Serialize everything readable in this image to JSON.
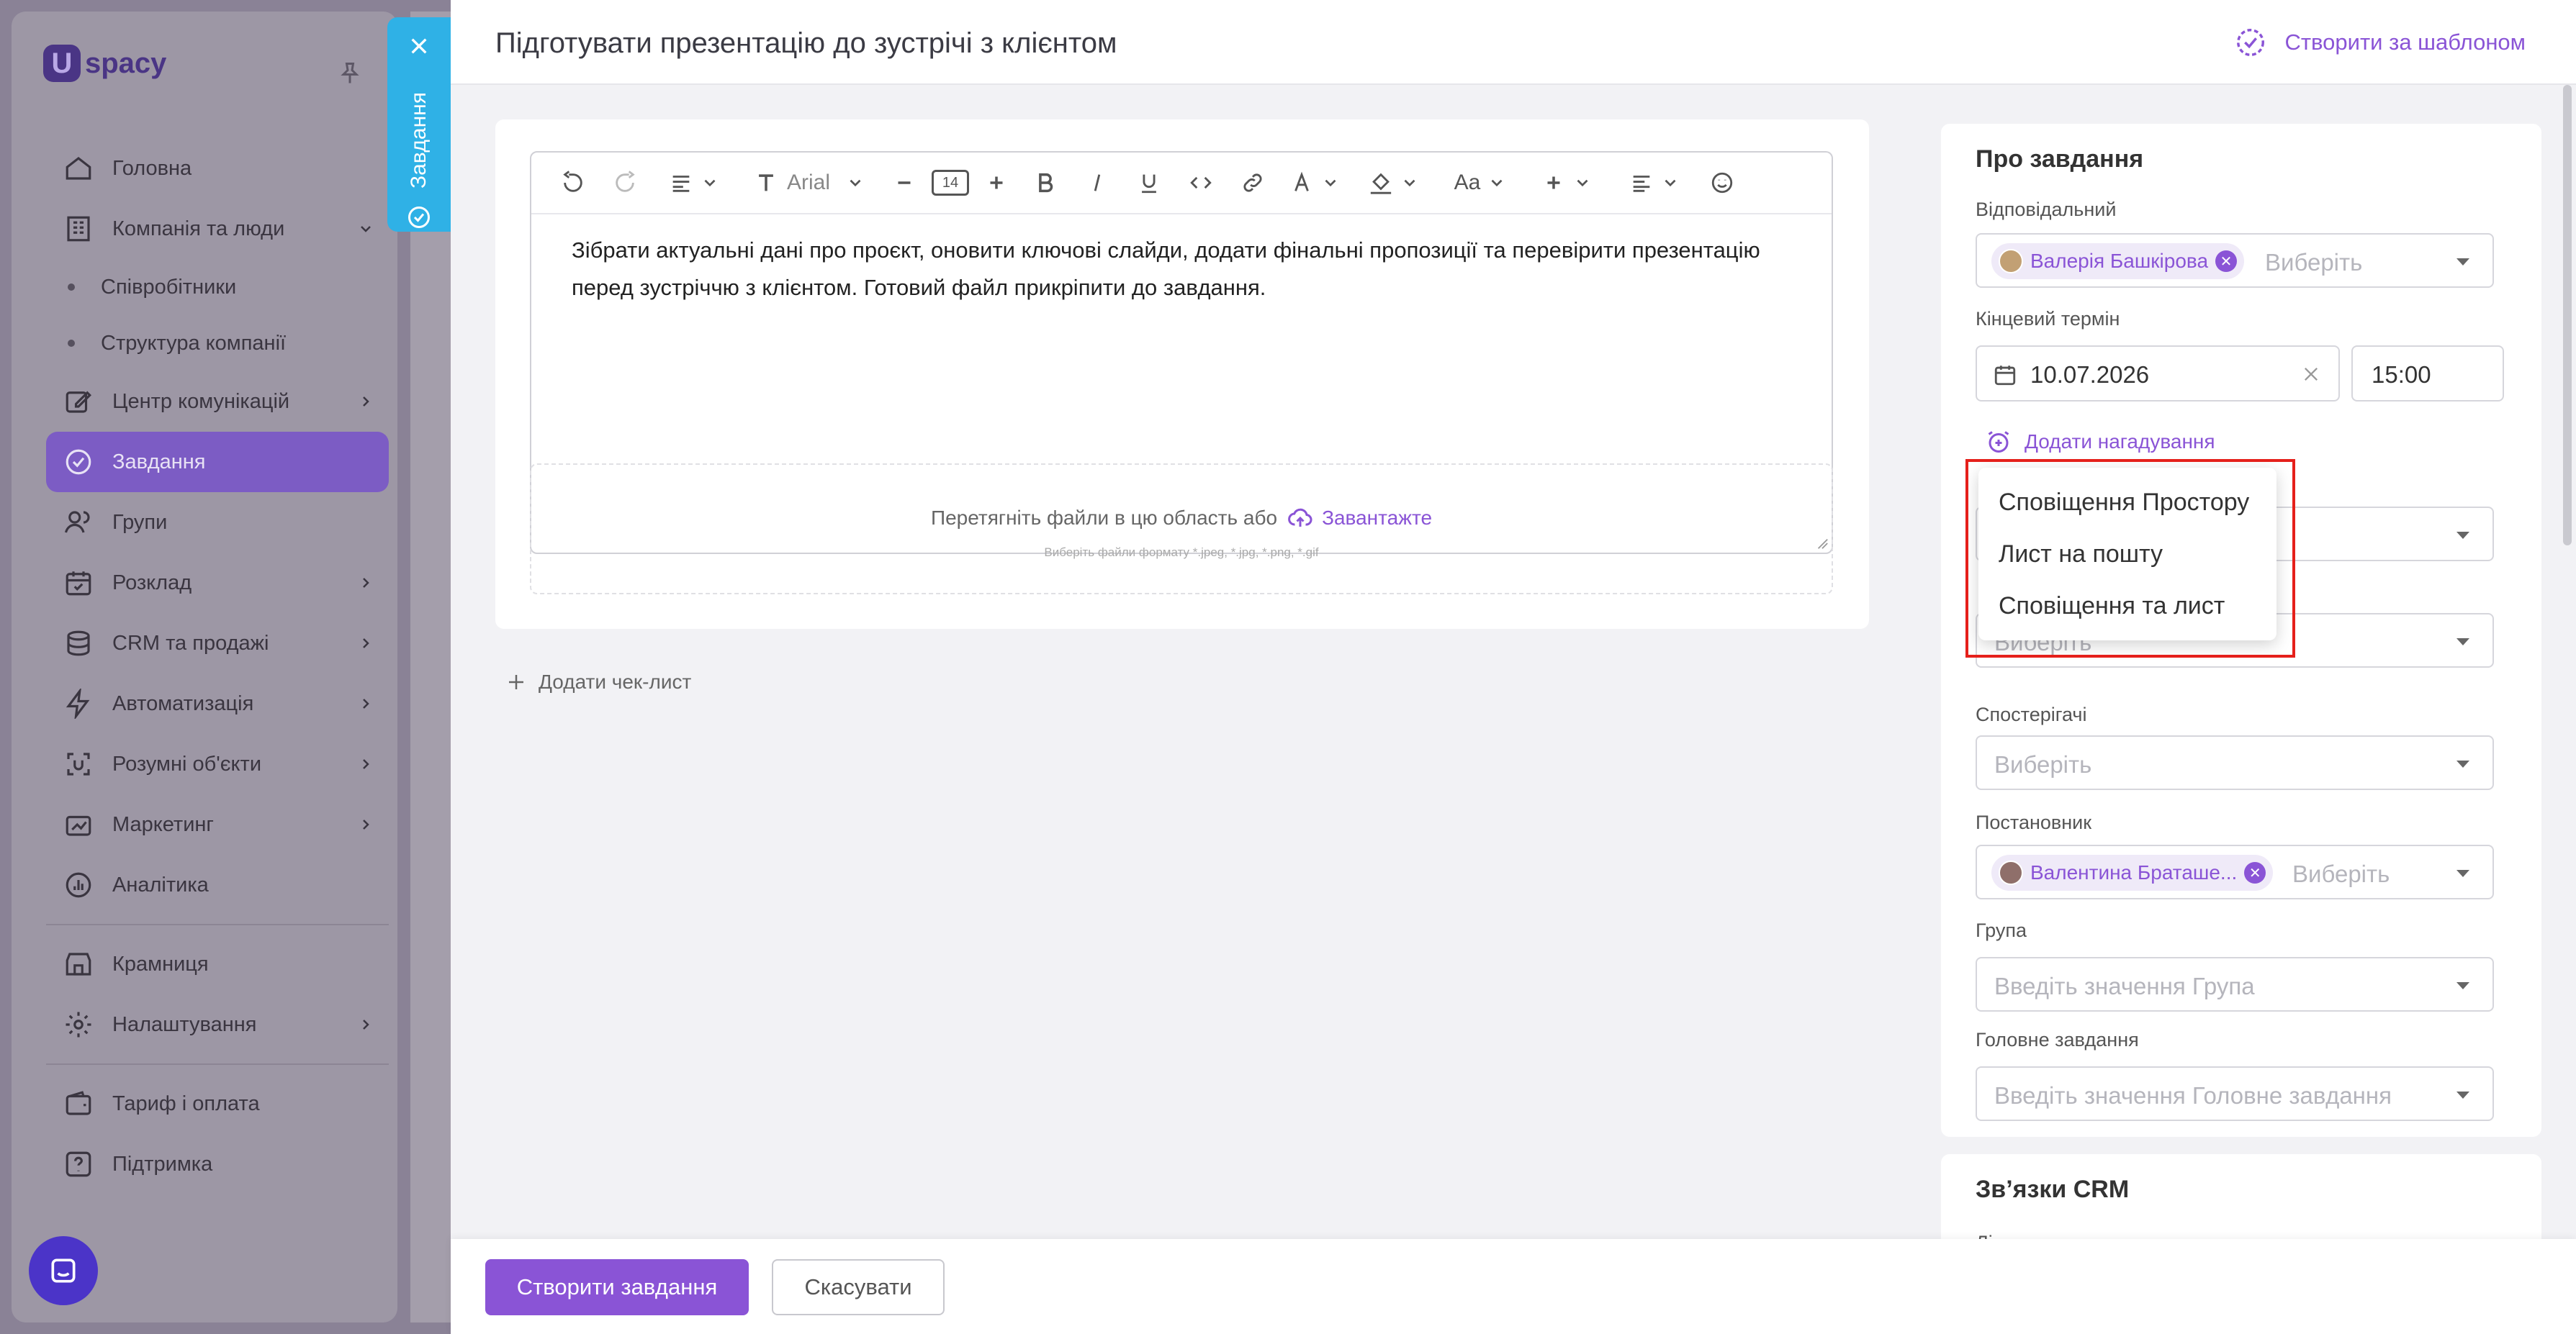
{
  "sidebar": {
    "logo_letter": "U",
    "logo_text": "spacy",
    "items": [
      {
        "label": "Головна"
      },
      {
        "label": "Компанія та люди"
      },
      {
        "label": "Співробітники"
      },
      {
        "label": "Структура компанії"
      },
      {
        "label": "Центр комунікацій"
      },
      {
        "label": "Завдання"
      },
      {
        "label": "Групи"
      },
      {
        "label": "Розклад"
      },
      {
        "label": "CRM та продажі"
      },
      {
        "label": "Автоматизація"
      },
      {
        "label": "Розумні об'єкти"
      },
      {
        "label": "Маркетинг"
      },
      {
        "label": "Аналітика"
      },
      {
        "label": "Крамниця"
      },
      {
        "label": "Налаштування"
      },
      {
        "label": "Тариф і оплата"
      },
      {
        "label": "Підтримка"
      }
    ]
  },
  "side_tab": {
    "label": "Завдання"
  },
  "header": {
    "title": "Підготувати презентацію до зустрічі з клієнтом",
    "template_label": "Створити за шаблоном"
  },
  "editor": {
    "font_name": "Arial",
    "font_size": "14",
    "text": "Зібрати актуальні дані про проєкт, оновити ключові слайди, додати фінальні пропозиції та перевірити презентацію перед зустріччю з клієнтом. Готовий файл прикріпити до завдання.",
    "format_label": "Aa"
  },
  "dropzone": {
    "text": "Перетягніть файли в цю область або",
    "link": "Завантажте",
    "hint": "Виберіть файли формату *.jpeg, *.jpg, *.png, *.gif"
  },
  "checklist": {
    "label": "Додати чек-лист"
  },
  "about": {
    "title": "Про завдання",
    "responsible_label": "Відповідальний",
    "responsible_chip": "Валерія Башкірова",
    "select_placeholder": "Виберіть",
    "deadline_label": "Кінцевий термін",
    "deadline_date": "10.07.2026",
    "deadline_time": "15:00",
    "reminder_label": "Додати нагадування",
    "observers_label": "Спостерігачі",
    "setter_label": "Постановник",
    "setter_chip": "Валентина Браташе...",
    "group_label": "Група",
    "group_placeholder": "Введіть значення Група",
    "parent_label": "Головне завдання",
    "parent_placeholder": "Введіть значення Головне завдання"
  },
  "reminder_menu": [
    {
      "label": "Сповіщення Простору"
    },
    {
      "label": "Лист на пошту"
    },
    {
      "label": "Сповіщення та лист"
    }
  ],
  "crm": {
    "title": "Зв’язки CRM",
    "sub": "Ліди"
  },
  "footer": {
    "create_label": "Створити завдання",
    "cancel_label": "Скасувати"
  },
  "colors": {
    "accent": "#8a54d6",
    "side_tab": "#2fb1e6",
    "highlight": "#e5201b",
    "chat": "#4b34c8"
  }
}
